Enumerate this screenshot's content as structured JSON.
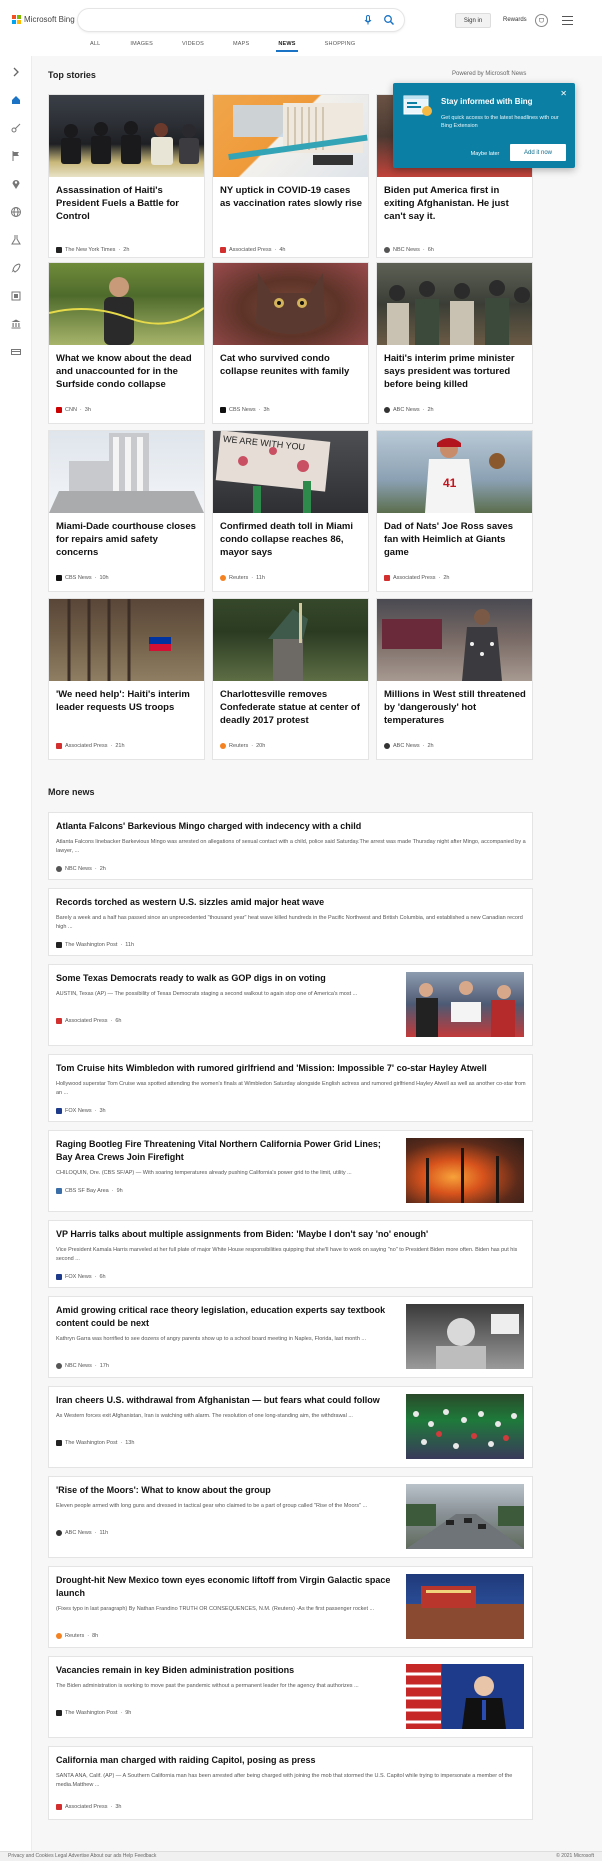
{
  "header": {
    "brand": "Microsoft Bing",
    "search_value": "",
    "signin_label": "Sign in",
    "rewards_label": "Rewards",
    "tabs": [
      {
        "label": "ALL"
      },
      {
        "label": "IMAGES"
      },
      {
        "label": "VIDEOS"
      },
      {
        "label": "MAPS"
      },
      {
        "label": "NEWS"
      },
      {
        "label": "SHOPPING"
      }
    ],
    "active_tab": "NEWS",
    "accent_color": "#1a73c4"
  },
  "rail": {
    "icons": [
      "chevron-right-icon",
      "home-icon",
      "sports-icon",
      "flag-icon",
      "location-pin-icon",
      "globe-icon",
      "science-icon",
      "rocket-icon",
      "film-icon",
      "bank-icon",
      "money-icon"
    ]
  },
  "top_stories": {
    "title": "Top stories",
    "powered_by": "Powered by Microsoft News",
    "cards": [
      {
        "title": "Assassination of Haiti's President Fuels a Battle for Control",
        "source": "The New York Times",
        "age": "2h"
      },
      {
        "title": "NY uptick in COVID-19 cases as vaccination rates slowly rise",
        "source": "Associated Press",
        "age": "4h"
      },
      {
        "title": "Biden put America first in exiting Afghanistan. He just can't say it.",
        "source": "NBC News",
        "age": "6h"
      },
      {
        "title": "What we know about the dead and unaccounted for in the Surfside condo collapse",
        "source": "CNN",
        "age": "3h"
      },
      {
        "title": "Cat who survived condo collapse reunites with family",
        "source": "CBS News",
        "age": "3h"
      },
      {
        "title": "Haiti's interim prime minister says president was tortured before being killed",
        "source": "ABC News",
        "age": "2h"
      },
      {
        "title": "Miami-Dade courthouse closes for repairs amid safety concerns",
        "source": "CBS News",
        "age": "10h"
      },
      {
        "title": "Confirmed death toll in Miami condo collapse reaches 86, mayor says",
        "source": "Reuters",
        "age": "11h"
      },
      {
        "title": "Dad of Nats' Joe Ross saves fan with Heimlich at Giants game",
        "source": "Associated Press",
        "age": "2h"
      },
      {
        "title": "'We need help': Haiti's interim leader requests US troops",
        "source": "Associated Press",
        "age": "21h"
      },
      {
        "title": "Charlottesville removes Confederate statue at center of deadly 2017 protest",
        "source": "Reuters",
        "age": "20h"
      },
      {
        "title": "Millions in West still threatened by 'dangerously' hot temperatures",
        "source": "ABC News",
        "age": "2h"
      }
    ]
  },
  "popup": {
    "title": "Stay informed with Bing",
    "description": "Get quick access to the latest headlines with our Bing Extension",
    "later_label": "Maybe later",
    "add_label": "Add it now",
    "close_label": "✕"
  },
  "more_news": {
    "title": "More news",
    "items": [
      {
        "title": "Atlanta Falcons' Barkevious Mingo charged with indecency with a child",
        "description": "Atlanta Falcons linebacker Barkevious Mingo was arrested on allegations of sexual contact with a child, police said Saturday.The arrest was made Thursday night after Mingo, accompanied by a lawyer, ...",
        "source": "NBC News",
        "age": "2h"
      },
      {
        "title": "Records torched as western U.S. sizzles amid major heat wave",
        "description": "Barely a week and a half has passed since an unprecedented \"thousand year\" heat wave killed hundreds in the Pacific Northwest and British Columbia, and established a new Canadian record high ...",
        "source": "The Washington Post",
        "age": "11h"
      },
      {
        "title": "Some Texas Democrats ready to walk as GOP digs in on voting",
        "description": "AUSTIN, Texas (AP) — The possibility of Texas Democrats staging a second walkout to again stop one of America's most ...",
        "source": "Associated Press",
        "age": "6h"
      },
      {
        "title": "Tom Cruise hits Wimbledon with rumored girlfriend and 'Mission: Impossible 7' co-star Hayley Atwell",
        "description": "Hollywood superstar Tom Cruise was spotted attending the women's finals at Wimbledon Saturday alongside English actress and rumored girlfriend Hayley Atwell as well as another co-star from an ...",
        "source": "FOX News",
        "age": "3h"
      },
      {
        "title": "Raging Bootleg Fire Threatening Vital Northern California Power Grid Lines; Bay Area Crews Join Firefight",
        "description": "CHILOQUIN, Ore. (CBS SF/AP) — With soaring temperatures already pushing California's power grid to the limit, utility ...",
        "source": "CBS SF Bay Area",
        "age": "9h"
      },
      {
        "title": "VP Harris talks about multiple assignments from Biden: 'Maybe I don't say 'no' enough'",
        "description": "Vice President Kamala Harris marveled at her full plate of major White House responsibilities quipping that she'll have to work on saying \"no\" to President Biden more often. Biden has put his second ...",
        "source": "FOX News",
        "age": "6h"
      },
      {
        "title": "Amid growing critical race theory legislation, education experts say textbook content could be next",
        "description": "Kathryn Garra was horrified to see dozens of angry parents show up to a school board meeting in Naples, Florida, last month ...",
        "source": "NBC News",
        "age": "17h"
      },
      {
        "title": "Iran cheers U.S. withdrawal from Afghanistan — but fears what could follow",
        "description": "As Western forces exit Afghanistan, Iran is watching with alarm. The resolution of one long-standing aim, the withdrawal ...",
        "source": "The Washington Post",
        "age": "13h"
      },
      {
        "title": "'Rise of the Moors': What to know about the group",
        "description": "Eleven people armed with long guns and dressed in tactical gear who claimed to be a part of group called \"Rise of the Moors\" ...",
        "source": "ABC News",
        "age": "11h"
      },
      {
        "title": "Drought-hit New Mexico town eyes economic liftoff from Virgin Galactic space launch",
        "description": "(Fixes typo in last paragraph) By Nathan Frandino TRUTH OR CONSEQUENCES, N.M. (Reuters) -As the first passenger rocket ...",
        "source": "Reuters",
        "age": "8h"
      },
      {
        "title": "Vacancies remain in key Biden administration positions",
        "description": "The Biden administration is working to move past the pandemic without a permanent leader for the agency that authorizes ...",
        "source": "The Washington Post",
        "age": "9h"
      },
      {
        "title": "California man charged with raiding Capitol, posing as press",
        "description": "SANTA ANA, Calif. (AP) — A Southern California man has been arrested after being charged with joining the mob that stormed the U.S. Capitol while trying to impersonate a member of the media.Matthew ...",
        "source": "Associated Press",
        "age": "3h"
      }
    ]
  },
  "footer": {
    "left_text": "Privacy and Cookies  Legal  Advertise  About our ads  Help  Feedback",
    "right_text": "© 2021 Microsoft"
  }
}
